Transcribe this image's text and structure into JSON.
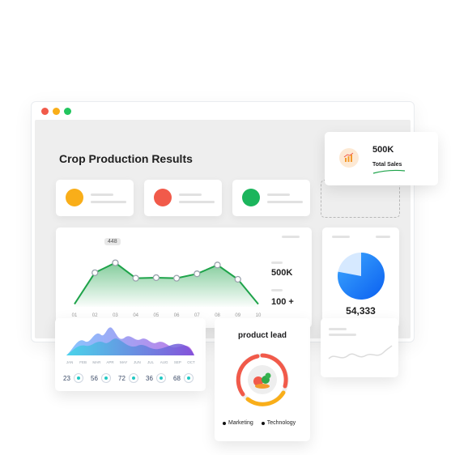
{
  "dashboard": {
    "title": "Crop Production Results"
  },
  "window_dots": {
    "red": "#f15a4a",
    "yellow": "#f9ae19",
    "green": "#22c55e"
  },
  "stat_cards": [
    {
      "color": "#f9ae19"
    },
    {
      "color": "#f15a4a"
    },
    {
      "color": "#1bb55c"
    }
  ],
  "total_sales": {
    "value": "500K",
    "label": "Total Sales"
  },
  "line_chart": {
    "tooltip": "448",
    "x_labels": [
      "01",
      "02",
      "03",
      "04",
      "05",
      "06",
      "07",
      "08",
      "09",
      "10"
    ],
    "values": [
      0.05,
      0.62,
      0.8,
      0.52,
      0.53,
      0.52,
      0.6,
      0.76,
      0.5,
      0.05
    ],
    "line_color": "#1ea34a",
    "stat_1": "500K",
    "stat_2": "100 +"
  },
  "pie_card": {
    "value": "54,333",
    "share": 0.22
  },
  "area_chart": {
    "x_labels": [
      "JAN",
      "FEB",
      "MAR",
      "APR",
      "MAY",
      "JUN",
      "JUL",
      "AUG",
      "SEP",
      "OCT"
    ],
    "kpis": [
      "23",
      "56",
      "72",
      "36",
      "68"
    ]
  },
  "product_lead": {
    "title": "product lead",
    "legend": [
      "Marketing",
      "Technology"
    ]
  }
}
